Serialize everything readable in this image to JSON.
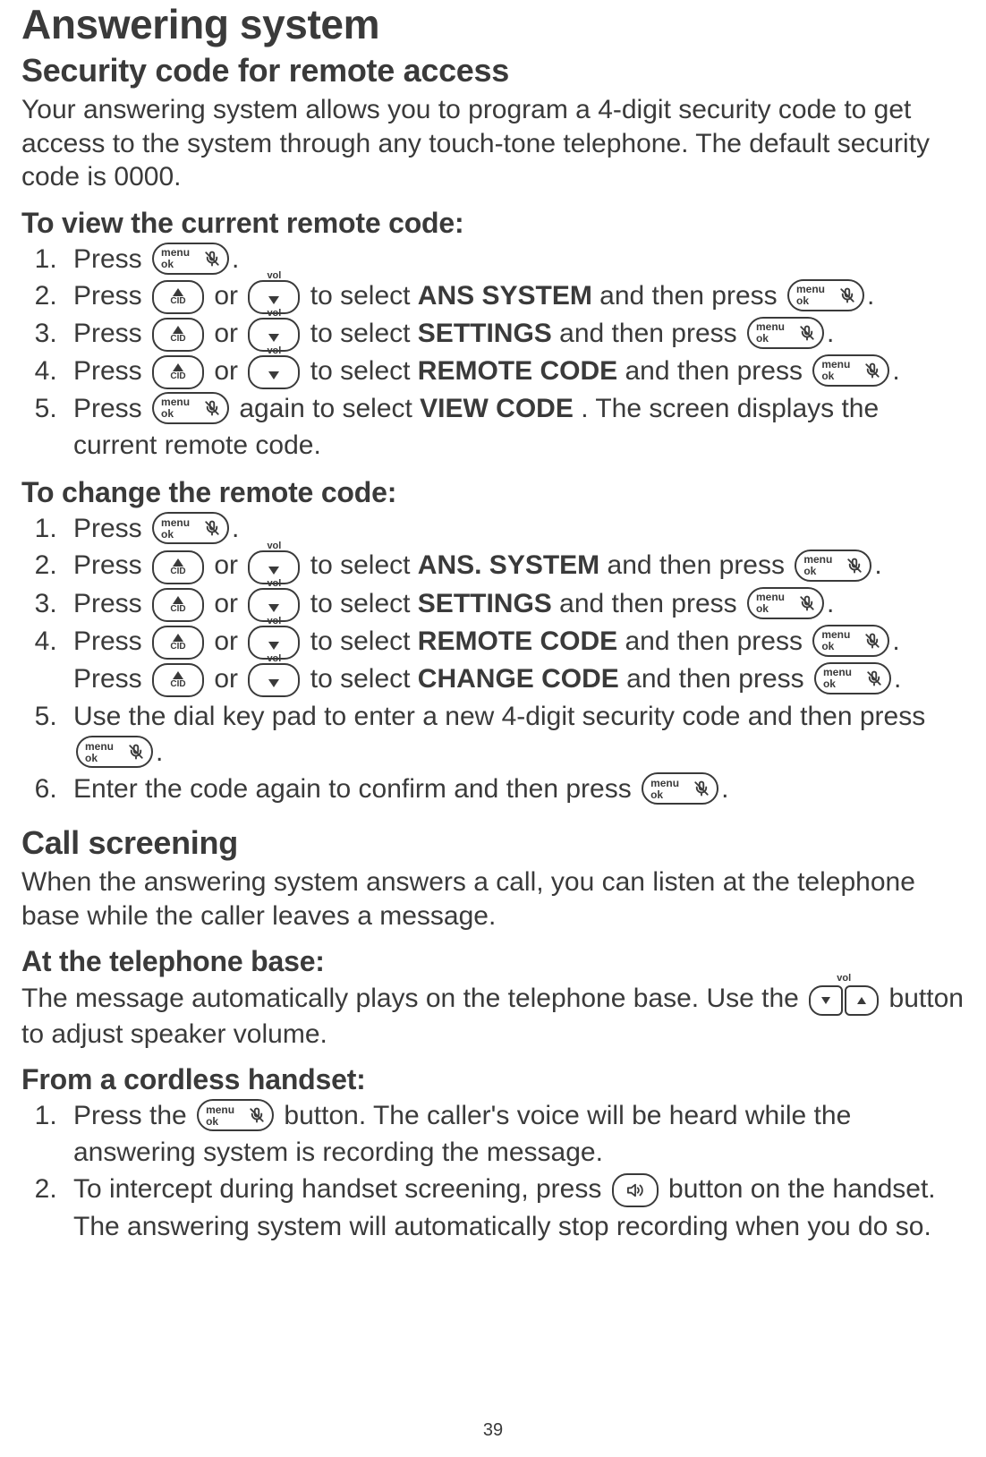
{
  "page_number": "39",
  "title": "Answering system",
  "section1": {
    "heading": "Security code for remote access",
    "intro": "Your answering system allows you to program a 4-digit security code to get access to the system through any touch-tone telephone. The default security code is 0000.",
    "view": {
      "heading": "To view the current remote code:",
      "steps": {
        "s1_a": "Press ",
        "s1_b": ".",
        "s2_a": "Press ",
        "s2_b": " or ",
        "s2_c": " to select ",
        "s2_bold": "ANS SYSTEM",
        "s2_d": " and then press ",
        "s2_e": ".",
        "s3_a": " Press ",
        "s3_b": " or ",
        "s3_c": " to select ",
        "s3_bold": "SETTINGS",
        "s3_d": " and then press ",
        "s3_e": ".",
        "s4_a": "Press ",
        "s4_b": " or ",
        "s4_c": " to select ",
        "s4_bold": "REMOTE CODE",
        "s4_d": " and then press ",
        "s4_e": ".",
        "s5_a": "Press ",
        "s5_b": " again to select ",
        "s5_bold": "VIEW CODE",
        "s5_c": ". The screen displays the current remote code."
      }
    },
    "change": {
      "heading": "To change the remote code:",
      "steps": {
        "s1_a": "Press ",
        "s1_b": ".",
        "s2_a": "Press ",
        "s2_b": " or ",
        "s2_c": " to select ",
        "s2_bold": "ANS. SYSTEM",
        "s2_d": " and then press ",
        "s2_e": ".",
        "s3_a": "Press ",
        "s3_b": " or ",
        "s3_c": " to select ",
        "s3_bold": "SETTINGS",
        "s3_d": " and then press ",
        "s3_e": ".",
        "s4_a": "Press ",
        "s4_b": " or ",
        "s4_c": " to select ",
        "s4_bold1": "REMOTE CODE",
        "s4_d": " and then press ",
        "s4_e": ". Press ",
        "s4_f": " or ",
        "s4_g": " to select ",
        "s4_bold2": "CHANGE CODE",
        "s4_h": " and then press ",
        "s4_i": ".",
        "s5_a": "Use the dial key pad to enter a new 4-digit security code and then press ",
        "s5_b": ".",
        "s6_a": "Enter the code again to confirm and then press ",
        "s6_b": "."
      }
    }
  },
  "section2": {
    "heading": "Call screening",
    "intro": "When the answering system answers a call, you can listen at the telephone base while the caller leaves a message.",
    "base": {
      "heading": "At the telephone base:",
      "text_a": "The message automatically plays on the telephone base. Use the ",
      "text_b": " button to adjust speaker volume."
    },
    "handset": {
      "heading": "From a cordless handset:",
      "s1_a": "Press the ",
      "s1_b": " button. The caller's voice will be heard while the answering system is recording the message.",
      "s2_a": "To intercept during handset screening, press ",
      "s2_b": " button on the handset. The answering system will automatically stop recording when you do so."
    }
  },
  "keys": {
    "menu_top": "menu",
    "menu_bottom": "ok",
    "cid": "CID",
    "vol": "vol"
  }
}
